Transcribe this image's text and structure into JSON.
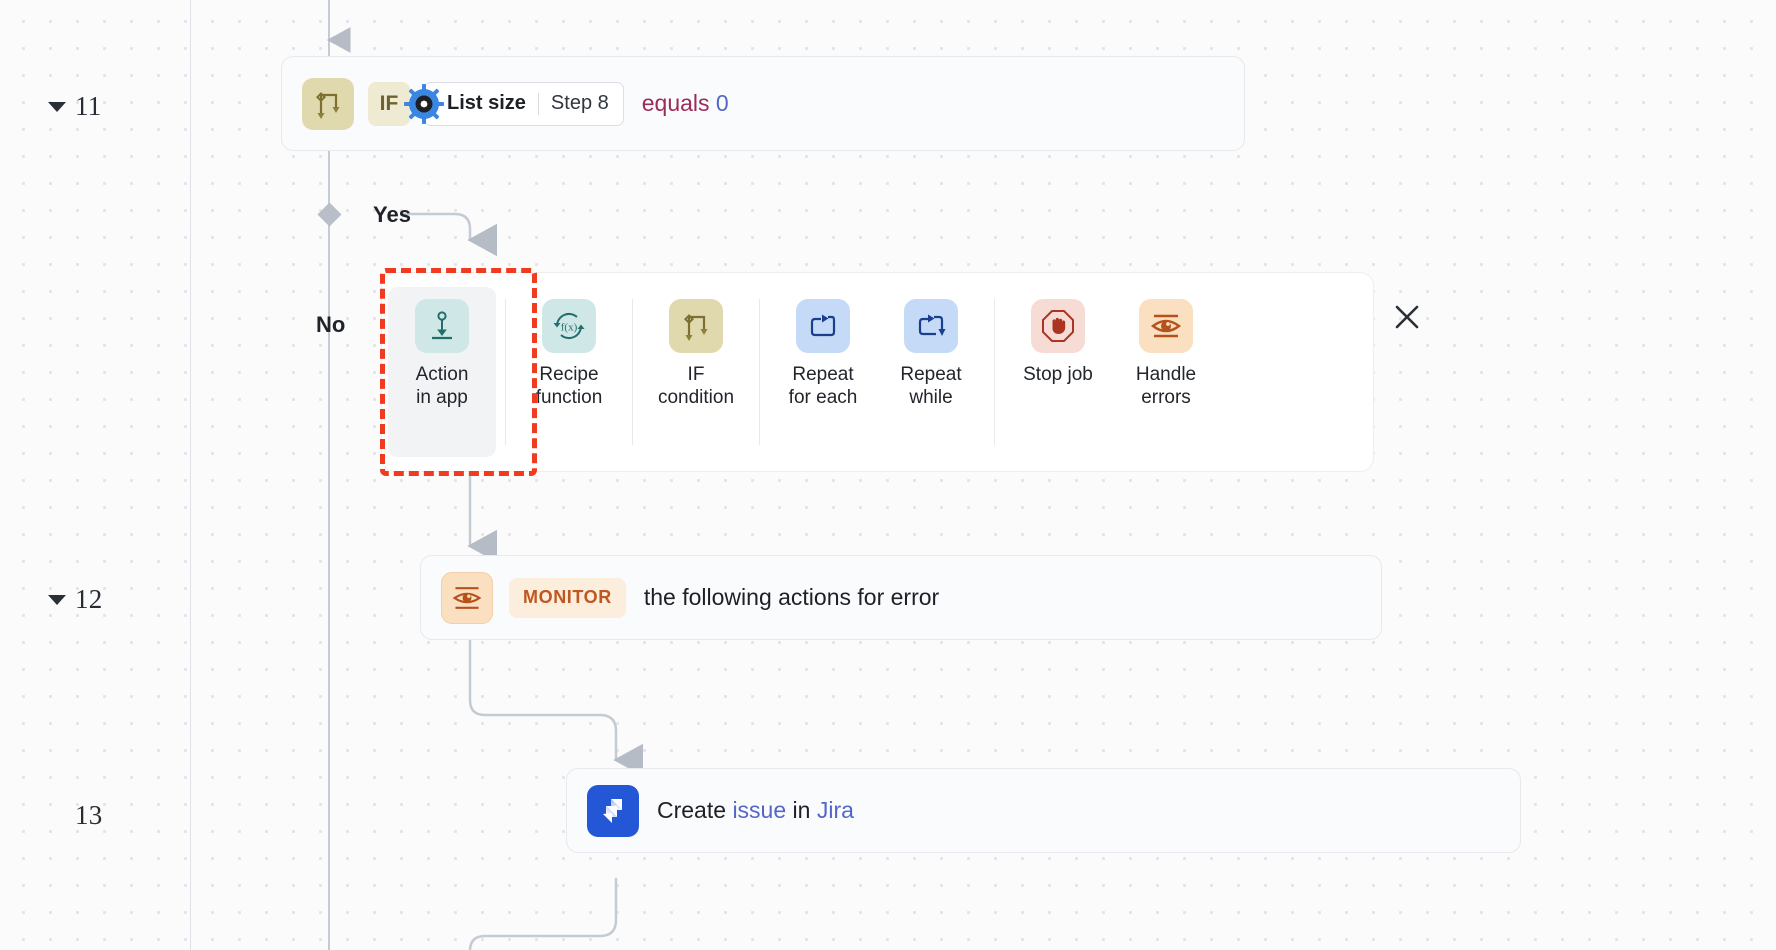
{
  "canvas": {
    "background_color": "#fbfbfc",
    "dot_color": "#e2e4e8",
    "trunk_color": "#c5cbd3"
  },
  "steps": [
    {
      "number": "11",
      "collapsible": true,
      "type": "if-condition",
      "icon": "if-branch-icon",
      "tag": "IF",
      "pill": {
        "icon": "gear-icon",
        "main": "List size",
        "sub": "Step 8"
      },
      "expression": {
        "operator": "equals",
        "value": "0"
      },
      "branches": [
        {
          "label": "Yes"
        },
        {
          "label": "No"
        }
      ]
    },
    {
      "number": "12",
      "collapsible": true,
      "type": "monitor",
      "icon": "eye-monitor-icon",
      "tag": "MONITOR",
      "text": "the following actions for error"
    },
    {
      "number": "13",
      "collapsible": false,
      "type": "app-action",
      "icon": "jira-icon",
      "text_parts": [
        {
          "text": "Create ",
          "style": "plain"
        },
        {
          "text": "issue",
          "style": "link"
        },
        {
          "text": " in ",
          "style": "plain"
        },
        {
          "text": "Jira",
          "style": "link"
        }
      ],
      "text_plain": "Create issue in Jira"
    }
  ],
  "action_picker": {
    "selected_index": 0,
    "selection_ring_color": "#f03b20",
    "close_label": "✕",
    "close_icon": "close-icon",
    "items": [
      {
        "label": "Action\nin app",
        "icon": "action-in-app-icon",
        "swatch": "#cfe8e7",
        "divider_after": true
      },
      {
        "label": "Recipe\nfunction",
        "icon": "recipe-function-icon",
        "swatch": "#cfe8e7",
        "divider_after": true
      },
      {
        "label": "IF\ncondition",
        "icon": "if-condition-icon",
        "swatch": "#e0d9ae",
        "divider_after": true
      },
      {
        "label": "Repeat\nfor each",
        "icon": "repeat-for-each-icon",
        "swatch": "#c5daf6",
        "divider_after": false
      },
      {
        "label": "Repeat\nwhile",
        "icon": "repeat-while-icon",
        "swatch": "#c5daf6",
        "divider_after": true
      },
      {
        "label": "Stop job",
        "icon": "stop-job-icon",
        "swatch": "#f7dcd6",
        "divider_after": false
      },
      {
        "label": "Handle\nerrors",
        "icon": "handle-errors-icon",
        "swatch": "#fadfc0",
        "divider_after": false
      }
    ]
  }
}
